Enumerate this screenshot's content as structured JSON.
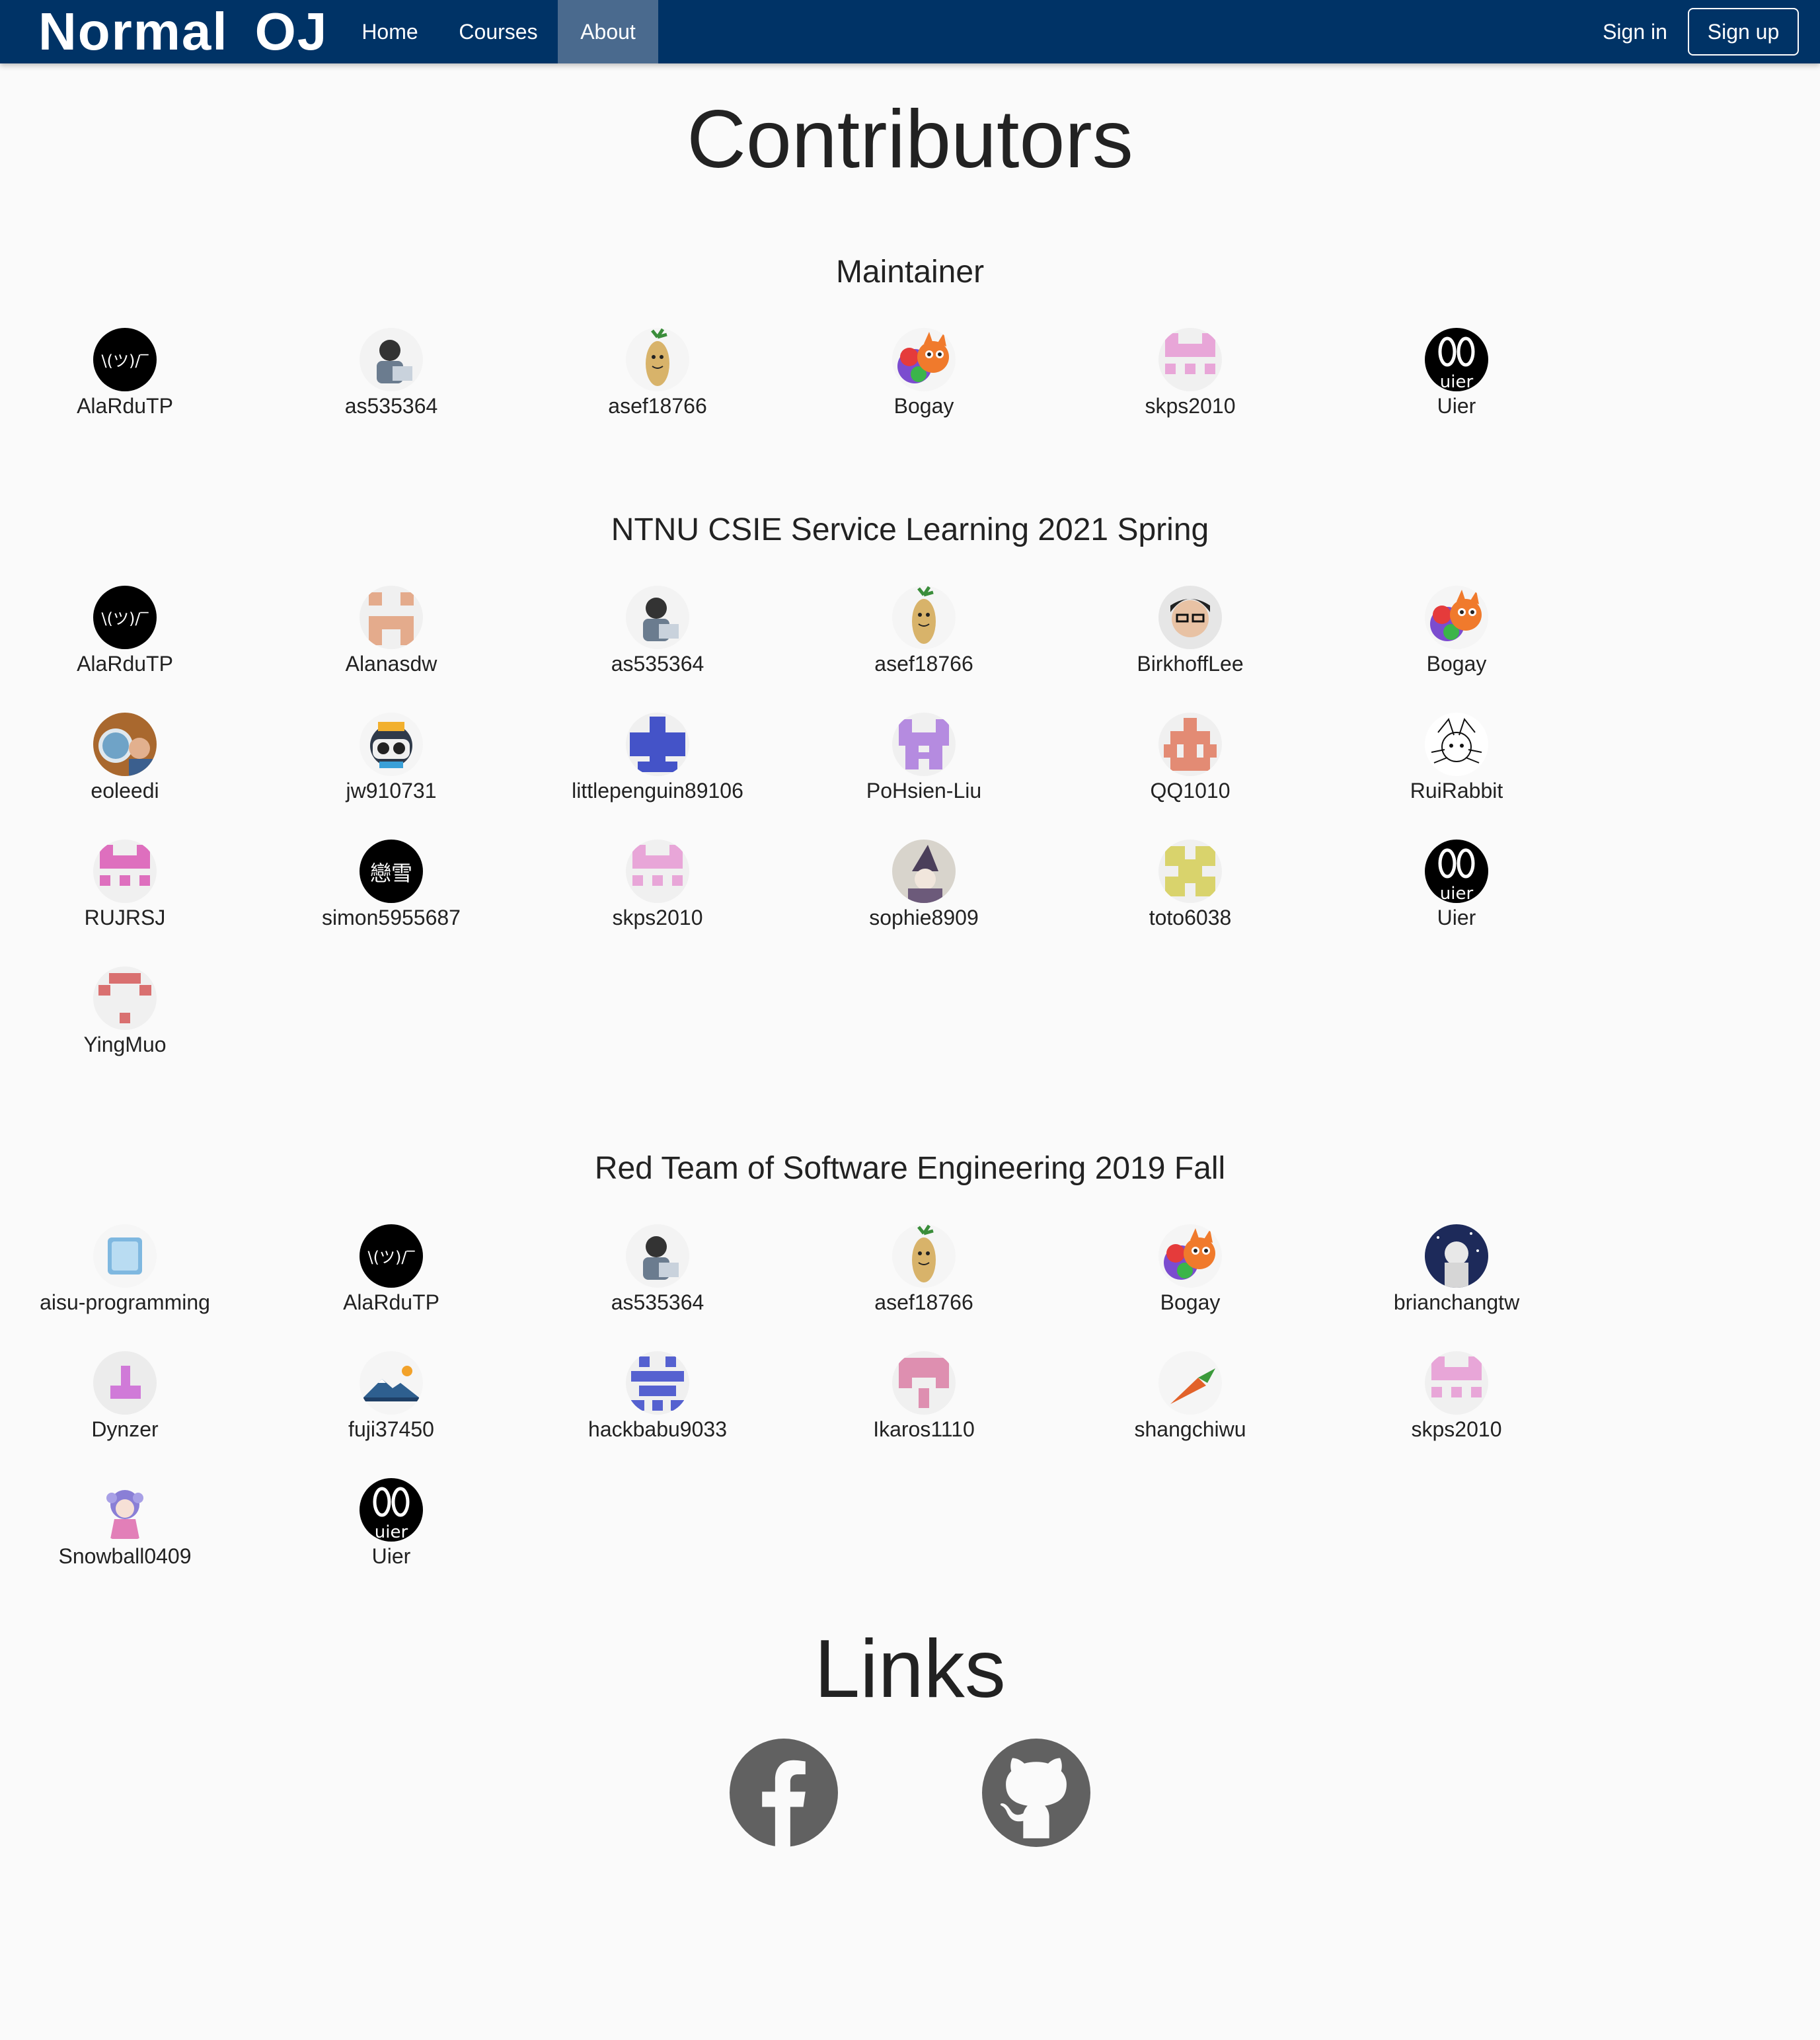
{
  "navbar": {
    "brand_part1": "Normal",
    "brand_part2": "OJ",
    "home": "Home",
    "courses": "Courses",
    "about": "About",
    "sign_in": "Sign in",
    "sign_up": "Sign up",
    "bg_color": "#003366",
    "active_color": "#4a6a8e"
  },
  "page": {
    "title": "Contributors",
    "links_title": "Links"
  },
  "sections": [
    {
      "title": "Maintainer",
      "members": [
        "AlaRduTP",
        "as535364",
        "asef18766",
        "Bogay",
        "skps2010",
        "Uier"
      ]
    },
    {
      "title": "NTNU CSIE Service Learning 2021 Spring",
      "members": [
        "AlaRduTP",
        "Alanasdw",
        "as535364",
        "asef18766",
        "BirkhoffLee",
        "Bogay",
        "eoleedi",
        "jw910731",
        "littlepenguin89106",
        "PoHsien-Liu",
        "QQ1010",
        "RuiRabbit",
        "RUJRSJ",
        "simon5955687",
        "skps2010",
        "sophie8909",
        "toto6038",
        "Uier",
        "YingMuo"
      ]
    },
    {
      "title": "Red Team of Software Engineering 2019 Fall",
      "members": [
        "aisu-programming",
        "AlaRduTP",
        "as535364",
        "asef18766",
        "Bogay",
        "brianchangtw",
        "Dynzer",
        "fuji37450",
        "hackbabu9033",
        "Ikaros1110",
        "shangchiwu",
        "skps2010",
        "Snowball0409",
        "Uier"
      ]
    }
  ],
  "avatar_badges": {
    "shrug": "\\(ツ)/‾",
    "uier": "uier",
    "simon": "戀雪"
  },
  "links": {
    "facebook_icon": "facebook-icon",
    "github_icon": "github-icon",
    "icon_color": "#616161"
  }
}
